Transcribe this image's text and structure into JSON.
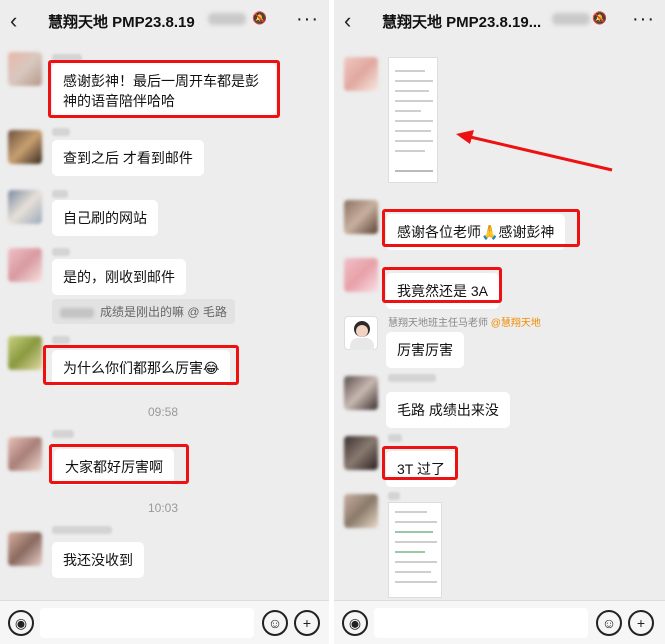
{
  "left": {
    "title": "慧翔天地 PMP23.8.19",
    "back_icon": "‹",
    "more_icon": "···",
    "messages": [
      {
        "text": "感谢彭神！最后一周开车都是彭"
      },
      {
        "text": "神的语音陪伴哈哈"
      },
      {
        "text": "查到之后 才看到邮件"
      },
      {
        "text": "自己刷的网站"
      },
      {
        "text": "是的，刚收到邮件"
      },
      {
        "text": "成绩是刚出的嘛 @ 毛路"
      },
      {
        "text": "为什么你们都那么厉害"
      },
      {
        "text": "09:58"
      },
      {
        "text": "大家都好厉害啊"
      },
      {
        "text": "10:03"
      },
      {
        "text": "我还没收到"
      }
    ]
  },
  "right": {
    "title": "慧翔天地 PMP23.8.19...",
    "back_icon": "‹",
    "more_icon": "···",
    "messages": [
      {
        "text": "感谢各位老师"
      },
      {
        "text": "感谢彭神"
      },
      {
        "text": "我竟然还是 3A"
      },
      {
        "text": "慧翔天地班主任马老师"
      },
      {
        "text": "@慧翔天地"
      },
      {
        "text": "厉害厉害"
      },
      {
        "text": "毛路 成绩出来没"
      },
      {
        "text": "3T 过了"
      }
    ]
  },
  "emoji": {
    "clap": "🙏",
    "laugh": "😂"
  },
  "inputbar": {
    "voice_icon": "◉",
    "emoji_icon": "☺",
    "plus_icon": "+"
  },
  "colors": {
    "highlight": "#ee1111",
    "bg": "#ededed",
    "bubble": "#ffffff"
  }
}
